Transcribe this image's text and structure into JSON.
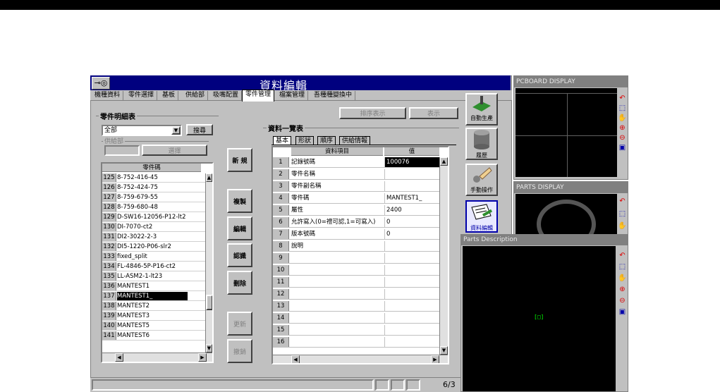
{
  "window": {
    "title": "資料編輯"
  },
  "tabs": [
    "機種資料",
    "零件選擇",
    "基板",
    "供給部",
    "吸嘴配置",
    "零件管理",
    "檔案管理",
    "吾種種變換中"
  ],
  "active_tab": "零件管理",
  "left_panel": {
    "title": "零件明細表",
    "filter_value": "全部",
    "search_button": "搜尋",
    "feeder_label": "供給部",
    "select_button": "選擇",
    "list_header": "零件碼",
    "rows": [
      {
        "no": "125",
        "code": "8-752-416-45"
      },
      {
        "no": "126",
        "code": "8-752-424-75"
      },
      {
        "no": "127",
        "code": "8-759-679-55"
      },
      {
        "no": "128",
        "code": "8-759-680-48"
      },
      {
        "no": "129",
        "code": "D-SW16-12056-P12-lt2"
      },
      {
        "no": "130",
        "code": "DI-7070-ct2"
      },
      {
        "no": "131",
        "code": "DI2-3022-2-3"
      },
      {
        "no": "132",
        "code": "DI5-1220-P06-slr2"
      },
      {
        "no": "133",
        "code": "fixed_split"
      },
      {
        "no": "134",
        "code": "FL-4846-5P-P16-ct2"
      },
      {
        "no": "135",
        "code": "LL-ASM2-1-lt23"
      },
      {
        "no": "136",
        "code": "MANTEST1"
      },
      {
        "no": "137",
        "code": "MANTEST1_"
      },
      {
        "no": "138",
        "code": "MANTEST2"
      },
      {
        "no": "139",
        "code": "MANTEST3"
      },
      {
        "no": "140",
        "code": "MANTEST5"
      },
      {
        "no": "141",
        "code": "MANTEST6"
      }
    ],
    "selected_row": "137"
  },
  "action_buttons": {
    "new": "新 規",
    "copy": "複製",
    "edit": "編輯",
    "confirm": "認識",
    "delete": "刪除",
    "update": "更新",
    "cancel": "撤銷"
  },
  "data_panel": {
    "title": "資料一覽表",
    "sort_button": "排序表示",
    "show_button": "表示",
    "subtabs": [
      "基本",
      "形狀",
      "順序",
      "供給情報"
    ],
    "col_item": "資料項目",
    "col_value": "值",
    "rows": [
      {
        "no": "1",
        "key": "記錄號碼",
        "value": "100076"
      },
      {
        "no": "2",
        "key": "零件名稱",
        "value": ""
      },
      {
        "no": "3",
        "key": "零件副名稱",
        "value": ""
      },
      {
        "no": "4",
        "key": "零件碼",
        "value": "MANTEST1_"
      },
      {
        "no": "5",
        "key": "屬性",
        "value": "2400"
      },
      {
        "no": "6",
        "key": "允許寫入(0=禮可認,1=可寫入)",
        "value": "0"
      },
      {
        "no": "7",
        "key": "版本號碼",
        "value": "0"
      },
      {
        "no": "8",
        "key": "說明",
        "value": ""
      },
      {
        "no": "9",
        "key": "",
        "value": ""
      },
      {
        "no": "10",
        "key": "",
        "value": ""
      },
      {
        "no": "11",
        "key": "",
        "value": ""
      },
      {
        "no": "12",
        "key": "",
        "value": ""
      },
      {
        "no": "13",
        "key": "",
        "value": ""
      },
      {
        "no": "14",
        "key": "",
        "value": ""
      },
      {
        "no": "15",
        "key": "",
        "value": ""
      },
      {
        "no": "16",
        "key": "",
        "value": ""
      }
    ]
  },
  "side_icons": {
    "auto": "自動生產",
    "history": "履歷",
    "manual": "手動操作",
    "data_edit": "資料編輯"
  },
  "status": {
    "page": "6/3"
  },
  "pcboard": {
    "title": "PCBOARD DISPLAY"
  },
  "parts_display": {
    "title": "PARTS DISPLAY"
  },
  "parts_description": {
    "title": "Parts Description",
    "symbol": "[□]"
  },
  "colors": {
    "title_bar": "#00007f",
    "panel_gray": "#c0c0c0",
    "green": "#00ff00"
  }
}
